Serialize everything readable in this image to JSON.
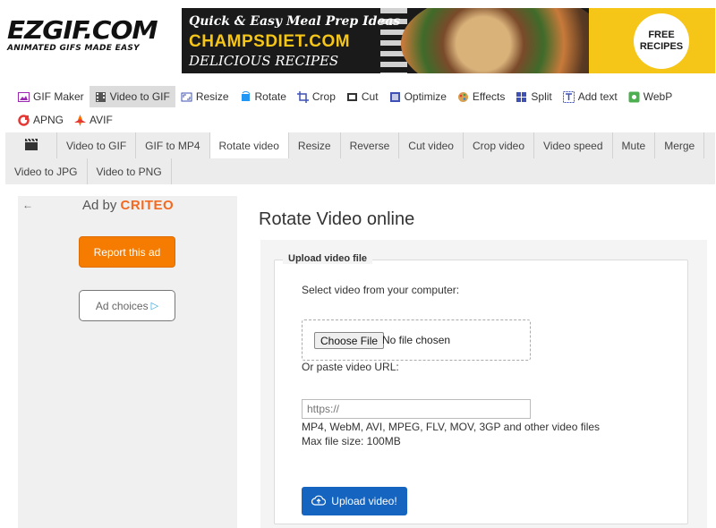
{
  "header": {
    "logo_main": "EZGIF.COM",
    "logo_sub": "ANIMATED GIFS MADE EASY",
    "banner": {
      "line1": "Quick & Easy Meal Prep Ideas",
      "line2": "CHAMPSDIET.COM",
      "line3": "DELICIOUS RECIPES",
      "badge": "FREE RECIPES"
    }
  },
  "topnav": {
    "row1": [
      {
        "label": "GIF Maker",
        "icon": "image-icon",
        "color": "#9c27b0"
      },
      {
        "label": "Video to GIF",
        "icon": "film-icon",
        "color": "#555555",
        "active": true
      },
      {
        "label": "Resize",
        "icon": "resize-icon",
        "color": "#3f51b5"
      },
      {
        "label": "Rotate",
        "icon": "rotate-icon",
        "color": "#2196f3"
      },
      {
        "label": "Crop",
        "icon": "crop-icon",
        "color": "#3f51b5"
      },
      {
        "label": "Cut",
        "icon": "cut-icon",
        "color": "#333333"
      },
      {
        "label": "Optimize",
        "icon": "optimize-icon",
        "color": "#3f51b5"
      },
      {
        "label": "Effects",
        "icon": "effects-icon",
        "color": "#c0792a"
      },
      {
        "label": "Split",
        "icon": "split-icon",
        "color": "#3f51b5"
      },
      {
        "label": "Add text",
        "icon": "text-icon",
        "color": "#3f51b5"
      },
      {
        "label": "WebP",
        "icon": "webp-icon",
        "color": "#4caf50"
      }
    ],
    "row2": [
      {
        "label": "APNG",
        "icon": "apng-icon",
        "color": "#e53935"
      },
      {
        "label": "AVIF",
        "icon": "avif-icon",
        "color": "#ff6f00"
      }
    ]
  },
  "subnav": {
    "row1": [
      "Video to GIF",
      "GIF to MP4",
      "Rotate video",
      "Resize",
      "Reverse",
      "Cut video",
      "Crop video",
      "Video speed",
      "Mute",
      "Merge"
    ],
    "row2": [
      "Video to JPG",
      "Video to PNG"
    ],
    "active": "Rotate video"
  },
  "ad": {
    "back": "←",
    "ad_by": "Ad by",
    "brand": "CRITEO",
    "report": "Report this ad",
    "choices": "Ad choices"
  },
  "main": {
    "title": "Rotate Video online",
    "legend": "Upload video file",
    "select_label": "Select video from your computer:",
    "choose_file": "Choose File",
    "no_file": "No file chosen",
    "paste_label": "Or paste video URL:",
    "url_placeholder": "https://",
    "formats": "MP4, WebM, AVI, MPEG, FLV, MOV, 3GP and other video files",
    "max_size": "Max file size: 100MB",
    "upload_button": "Upload video!"
  }
}
